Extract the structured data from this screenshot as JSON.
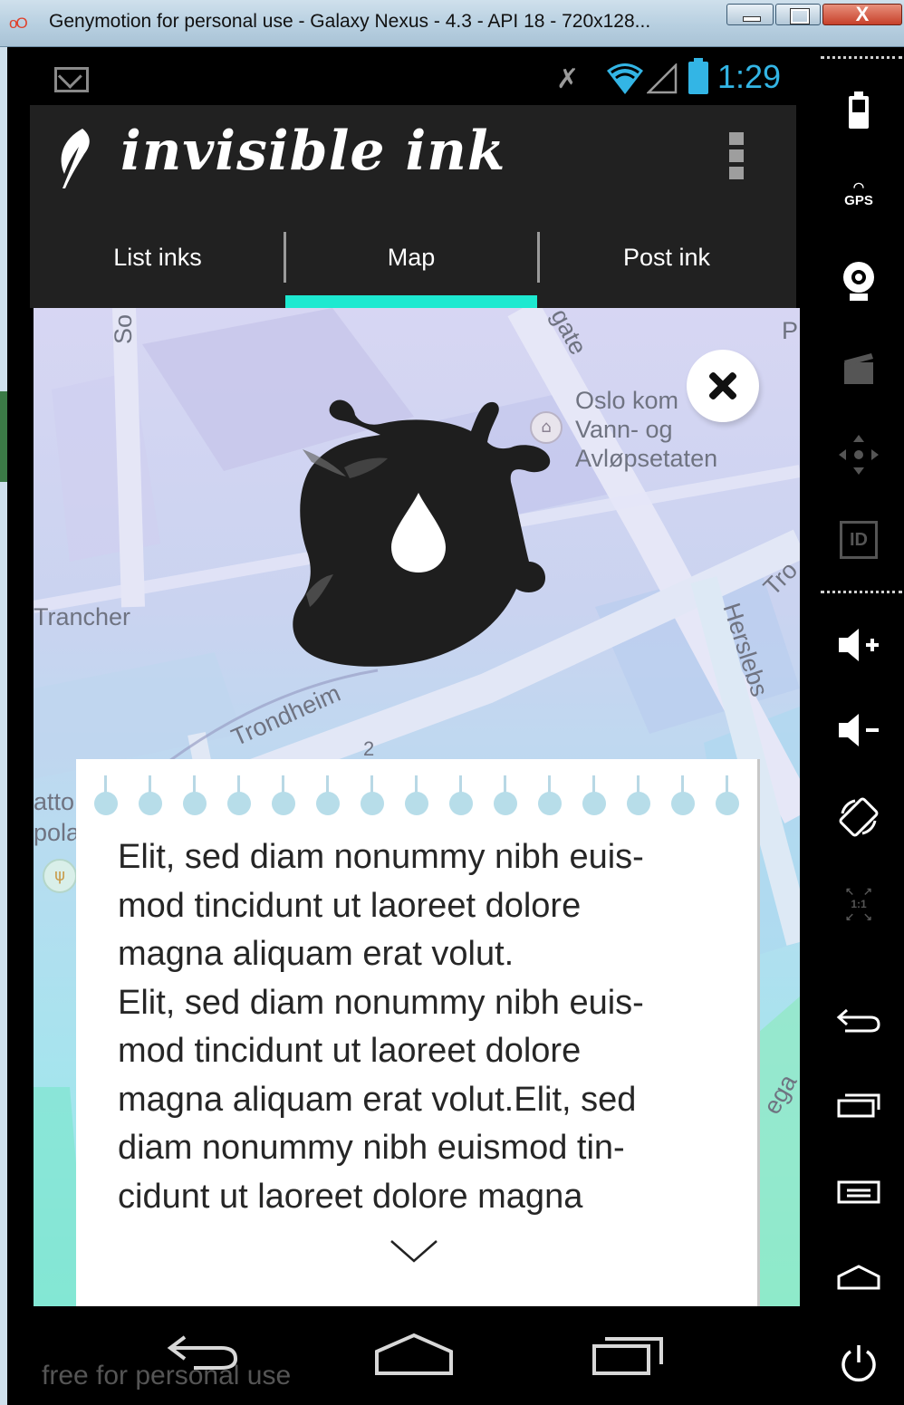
{
  "window": {
    "logo": "oO",
    "title": "Genymotion for personal use - Galaxy Nexus - 4.3 - API 18 - 720x128...",
    "close_label": "X"
  },
  "status_bar": {
    "time": "1:29",
    "icons": [
      "gmail-icon",
      "mute-icon",
      "wifi-icon",
      "signal-icon",
      "battery-icon"
    ]
  },
  "app": {
    "title": "invisible ink",
    "tabs": [
      {
        "label": "List inks",
        "selected": false
      },
      {
        "label": "Map",
        "selected": true
      },
      {
        "label": "Post ink",
        "selected": false
      }
    ],
    "accent_color": "#1de9d0",
    "bar_color": "#212121"
  },
  "map": {
    "labels": {
      "oslo_line1": "Oslo kom",
      "oslo_line2": "Vann- og",
      "oslo_line3": "Avløpsetaten",
      "trancher": "Trancher",
      "trondheim": "Trondheim",
      "herslebs": "Herslebs",
      "gate": "gate",
      "so": "So",
      "tro": "Tro",
      "p": "P",
      "atto": "atto",
      "pola": "pola",
      "rega": "ega",
      "num": "2"
    }
  },
  "note": {
    "text": "Elit, sed diam nonummy nibh euis-mod tincidunt ut laoreet dolore magna aliquam erat volut.\nElit, sed diam nonummy nibh euis-mod tincidunt ut laoreet dolore magna aliquam erat volut.Elit, sed diam nonummy nibh euismod tin-cidunt ut laoreet dolore magna",
    "lines": [
      "Elit, sed diam nonummy nibh euis-",
      "mod tincidunt ut laoreet dolore",
      "magna aliquam erat volut.",
      "Elit, sed diam nonummy nibh euis-",
      "mod tincidunt ut laoreet dolore",
      "magna aliquam erat volut.Elit, sed",
      "diam nonummy nibh euismod tin-",
      "cidunt ut laoreet dolore magna"
    ]
  },
  "navigation": {
    "watermark": "free for personal use"
  },
  "sidebar": {
    "gps_label": "GPS",
    "id_label": "ID",
    "ratio_label": "1:1"
  }
}
